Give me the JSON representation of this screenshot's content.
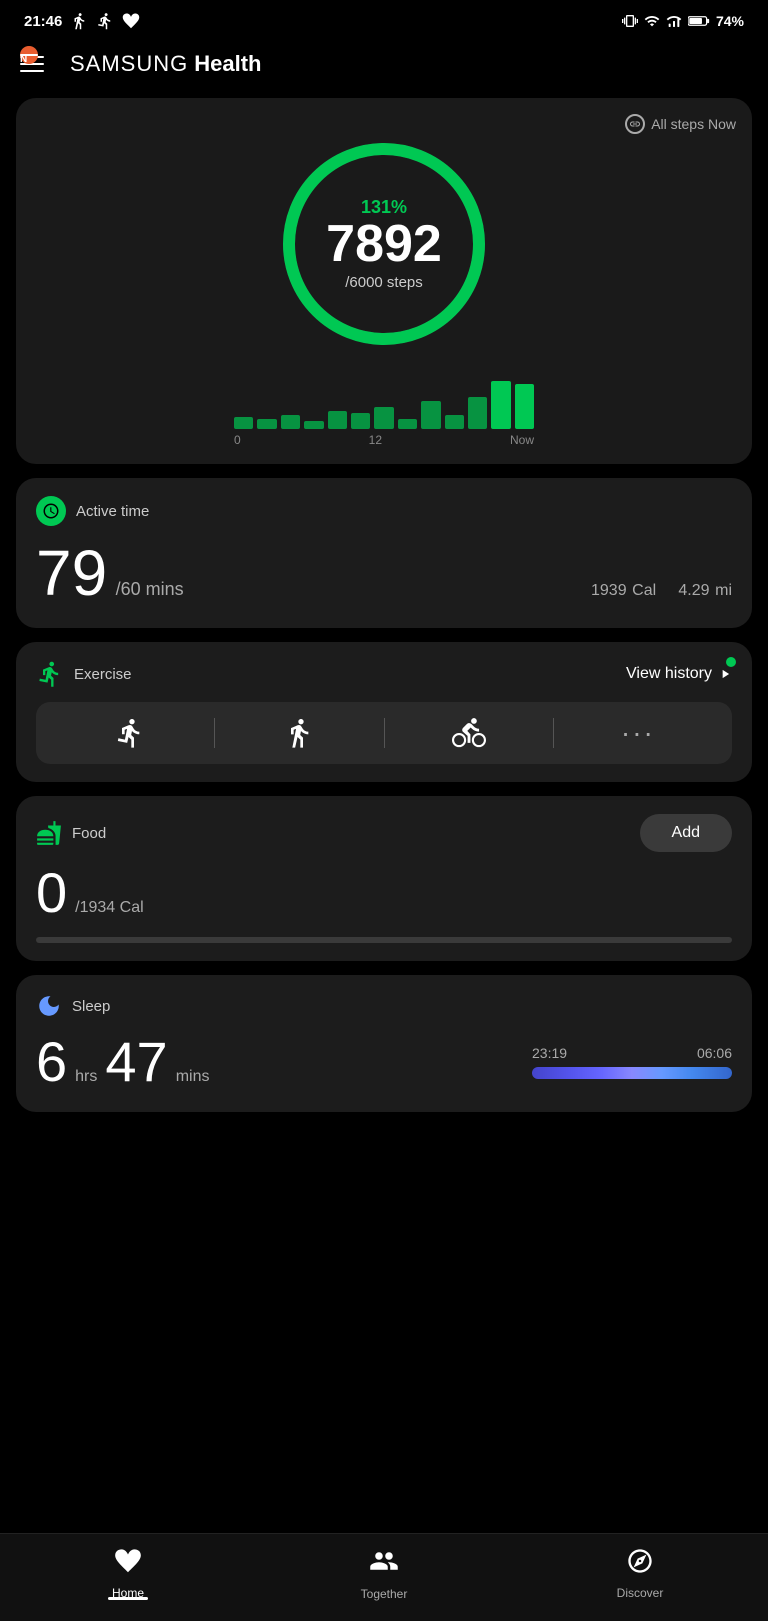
{
  "statusBar": {
    "time": "21:46",
    "battery": "74%"
  },
  "header": {
    "notification": "N",
    "appName": "SAMSUNG",
    "appSub": "Health"
  },
  "stepsCard": {
    "allStepsLabel": "All steps Now",
    "percent": "131%",
    "steps": "7892",
    "goal": "/6000 steps",
    "chartLabels": [
      "0",
      "12",
      "Now"
    ]
  },
  "activeTimeCard": {
    "label": "Active time",
    "value": "79",
    "unit": "/60 mins",
    "calories": "1939",
    "calUnit": "Cal",
    "distance": "4.29",
    "distUnit": "mi"
  },
  "exerciseCard": {
    "label": "Exercise",
    "viewHistory": "View history",
    "greenDot": true
  },
  "foodCard": {
    "label": "Food",
    "addLabel": "Add",
    "value": "0",
    "unit": "/1934 Cal",
    "progress": 0
  },
  "sleepCard": {
    "label": "Sleep",
    "hours": "6",
    "hrsUnit": "hrs",
    "mins": "47",
    "minsUnit": "mins",
    "startTime": "23:19",
    "endTime": "06:06"
  },
  "bottomNav": {
    "items": [
      {
        "label": "Home",
        "icon": "home",
        "active": true
      },
      {
        "label": "Together",
        "icon": "together",
        "active": false
      },
      {
        "label": "Discover",
        "icon": "discover",
        "active": false
      }
    ]
  }
}
